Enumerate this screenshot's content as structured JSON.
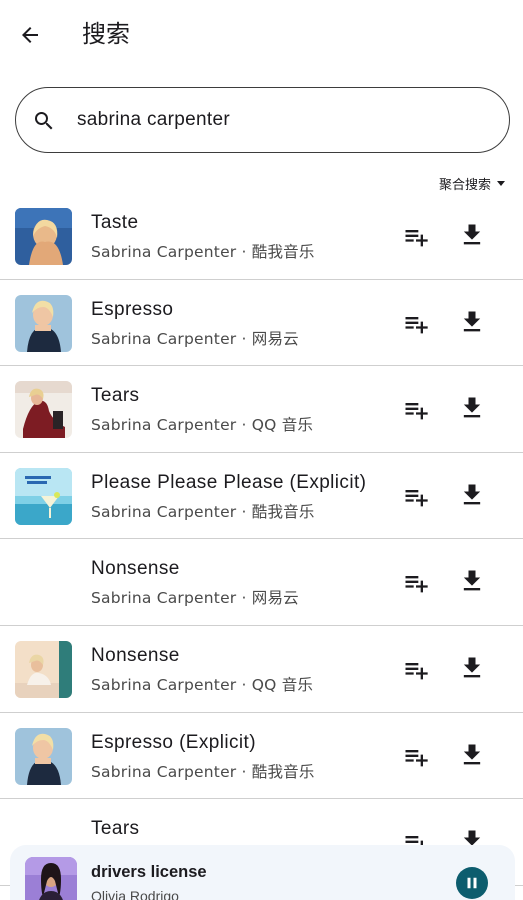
{
  "app": {
    "title": "搜索",
    "back_icon": "arrow-back-icon"
  },
  "search": {
    "value": "sabrina carpenter",
    "icon": "search-icon"
  },
  "filter": {
    "label": "聚合搜索",
    "icon": "arrow-drop-down-icon"
  },
  "results": [
    {
      "title": "Taste",
      "subtitle": "Sabrina Carpenter · 酷我音乐"
    },
    {
      "title": "Espresso",
      "subtitle": "Sabrina Carpenter · 网易云"
    },
    {
      "title": "Tears",
      "subtitle": "Sabrina Carpenter · QQ 音乐"
    },
    {
      "title": "Please Please Please (Explicit)",
      "subtitle": "Sabrina Carpenter · 酷我音乐"
    },
    {
      "title": "Nonsense",
      "subtitle": "Sabrina Carpenter · 网易云"
    },
    {
      "title": "Nonsense",
      "subtitle": "Sabrina Carpenter · QQ 音乐"
    },
    {
      "title": "Espresso (Explicit)",
      "subtitle": "Sabrina Carpenter · 酷我音乐"
    },
    {
      "title": "Tears",
      "subtitle": ""
    }
  ],
  "row_actions": {
    "add_icon": "playlist-add-icon",
    "download_icon": "download-icon"
  },
  "now_playing": {
    "title": "drivers license",
    "artist": "Olivia Rodrigo",
    "control_icon": "pause-icon"
  },
  "colors": {
    "accent": "#0d5d6e",
    "player_bg": "#f2f6fb",
    "divider": "#cfcfcf"
  }
}
